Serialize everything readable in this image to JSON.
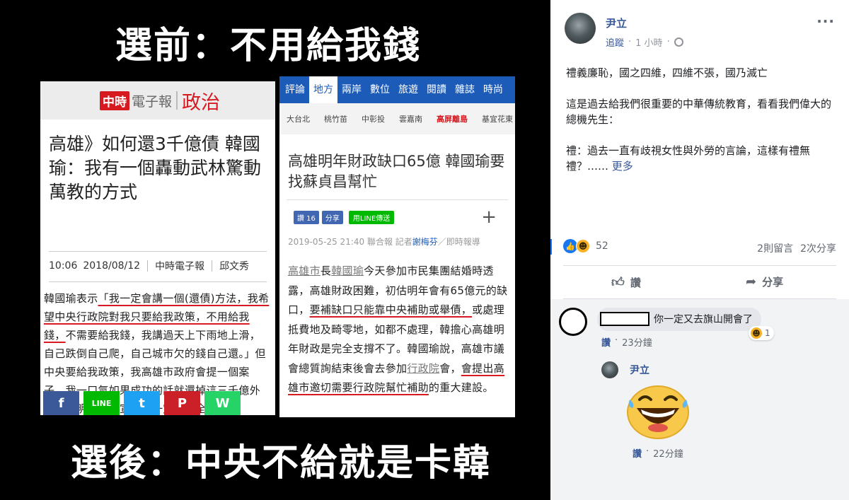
{
  "image": {
    "headline_top": "選前：不用給我錢",
    "headline_bottom": "選後：中央不給就是卡韓",
    "left_article": {
      "logo_brand": "中時",
      "logo_name": "電子報",
      "logo_section": "政治",
      "title": "高雄》如何還3千億債 韓國瑜：我有一個轟動武林驚動萬教的方式",
      "time": "10:06",
      "date": "2018/08/12",
      "source": "中時電子報",
      "author": "邱文秀",
      "body_pre": "韓國瑜表示",
      "body_highlight": "「我一定會講一個(還債)方法，我希望中央行政院對我只要給我政策，不用給我錢，",
      "body_post": "不需要給我錢，我講過天上下雨地上滑，自己跌倒自己爬，自己城市欠的錢自己還。」但中央要給我政策，我高雄市政府會提一個案子，我一口氣如果成功的話就還掉這三千億外債，我明天就會宣布，一定轟動全台灣。",
      "share_icons": [
        {
          "label": "f",
          "color": "#3b5998"
        },
        {
          "label": "LINE",
          "color": "#00b900"
        },
        {
          "label": "t",
          "color": "#1da1f2"
        },
        {
          "label": "P",
          "color": "#cb2027"
        },
        {
          "label": "W",
          "color": "#25d366"
        }
      ]
    },
    "right_article": {
      "nav": [
        "評論",
        "地方",
        "兩岸",
        "數位",
        "旅遊",
        "閱讀",
        "雜誌",
        "時尚"
      ],
      "nav_active": 1,
      "subnav": [
        "大台北",
        "桃竹苗",
        "中彰投",
        "雲嘉南",
        "高屏離島",
        "基宜花東"
      ],
      "subnav_active": 4,
      "title": "高雄明年財政缺口65億 韓國瑜要找蘇貞昌幫忙",
      "like_label": "讚 16",
      "share_label": "分享",
      "line_label": "用LINE傳送",
      "plus": "+",
      "dateline": "2019-05-25 21:40  聯合報  記者",
      "reporter": "謝梅芬",
      "dateline_tail": "／即時報導",
      "body_link1": "高雄市",
      "body_mid1": "長",
      "body_link2": "韓國瑜",
      "body_a": "今天參加市民集團結婚時透露，高雄財政困難，初估明年會有65億元的缺口，",
      "body_highlight1": "要補缺口只能靠中央補助或舉債，",
      "body_b": "或處理抵費地及畸零地，如都不處理，韓擔心高雄明年財政是完全支撐不了。韓國瑜說，高雄市議會總質詢結束後會去參加",
      "body_link3": "行政院",
      "body_c": "會，",
      "body_highlight2": "會提出高雄市邀切需要行政院幫忙補助",
      "body_d": "的重大建設。"
    }
  },
  "post": {
    "author": "尹立",
    "follow": "追蹤",
    "time": "1 小時",
    "dot": "·",
    "more": "···",
    "paragraphs": [
      "禮義廉恥，國之四維，四維不張，國乃滅亡",
      "這是過去給我們很重要的中華傳統教育，看看我們偉大的總機先生："
    ],
    "last_paragraph": "禮：過去一直有歧視女性與外勞的言論，這樣有禮無禮？……",
    "more_link": "更多",
    "reaction_count": "52",
    "comments_count": "2則留言",
    "shares_count": "2次分享",
    "like_button": "讚",
    "share_button": "分享"
  },
  "comments": [
    {
      "text": "你一定又去旗山開會了",
      "reaction_count": "1",
      "like": "讚",
      "dot": "·",
      "time": "23分鐘"
    },
    {
      "author": "尹立",
      "like": "讚",
      "dot": "·",
      "time": "22分鐘"
    }
  ]
}
